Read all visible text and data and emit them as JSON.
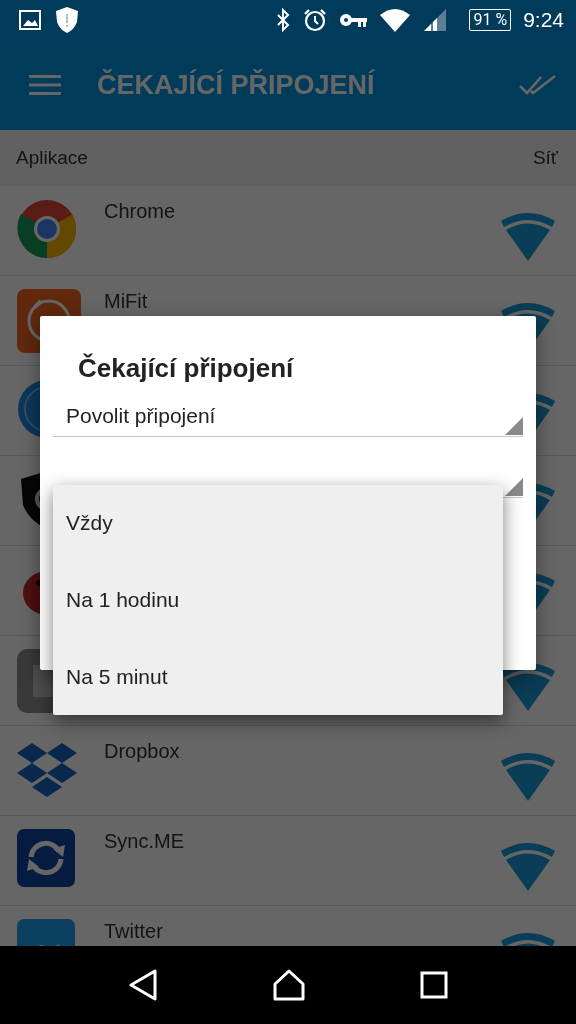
{
  "status_bar": {
    "battery": "91 %",
    "time": "9:24"
  },
  "toolbar": {
    "title": "ČEKAJÍCÍ PŘIPOJENÍ"
  },
  "list_header": {
    "column_1": "Aplikace",
    "column_2": "Síť"
  },
  "apps": [
    {
      "kind": "app",
      "name": "Chrome"
    },
    {
      "kind": "app",
      "name": "MiFit"
    },
    {
      "kind": "app"
    },
    {
      "kind": "app"
    },
    {
      "kind": "app"
    },
    {
      "kind": "app"
    },
    {
      "kind": "app",
      "name": "Dropbox"
    },
    {
      "kind": "app",
      "name": "Sync.ME"
    },
    {
      "kind": "app",
      "name": "Twitter"
    }
  ],
  "dialog": {
    "title": "Čekající připojení",
    "spinners": [
      {
        "kind": "spinner",
        "value": "Povolit připojení"
      },
      {
        "kind": "spinner"
      }
    ]
  },
  "dropdown": {
    "options": [
      {
        "label": "Vždy",
        "selected": false
      },
      {
        "label": "Na 1 hodinu",
        "selected": false
      },
      {
        "label": "Na 5 minut",
        "selected": false
      }
    ]
  }
}
